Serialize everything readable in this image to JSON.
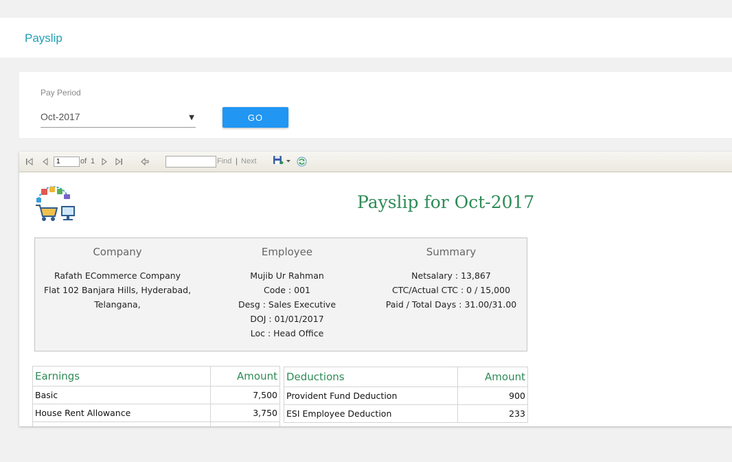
{
  "header": {
    "title": "Payslip"
  },
  "filter": {
    "label": "Pay Period",
    "selected": "Oct-2017",
    "go_label": "GO"
  },
  "toolbar": {
    "page_value": "1",
    "of_label": "of",
    "total_pages": "1",
    "find_label": "Find",
    "separator": "|",
    "next_label": "Next",
    "find_value": ""
  },
  "report": {
    "title": "Payslip for Oct-2017",
    "company": {
      "heading": "Company",
      "lines": [
        "Rafath ECommerce Company",
        "Flat 102 Banjara Hills, Hyderabad,",
        "Telangana,"
      ]
    },
    "employee": {
      "heading": "Employee",
      "lines": [
        "Mujib Ur Rahman",
        "Code : 001",
        "Desg : Sales Executive",
        "DOJ : 01/01/2017",
        "Loc : Head Office"
      ]
    },
    "summary": {
      "heading": "Summary",
      "lines": [
        "Netsalary : 13,867",
        "CTC/Actual CTC : 0 / 15,000",
        "Paid / Total Days : 31.00/31.00"
      ]
    },
    "earnings": {
      "headers": [
        "Earnings",
        "Amount"
      ],
      "rows": [
        [
          "Basic",
          "7,500"
        ],
        [
          "House Rent Allowance",
          "3,750"
        ],
        [
          "",
          ""
        ]
      ]
    },
    "deductions": {
      "headers": [
        "Deductions",
        "Amount"
      ],
      "rows": [
        [
          "Provident Fund Deduction",
          "900"
        ],
        [
          "ESI Employee Deduction",
          "233"
        ]
      ]
    }
  },
  "colors": {
    "accent": "#1f9fb3",
    "button": "#2196f3",
    "report_green": "#2e8b57"
  }
}
